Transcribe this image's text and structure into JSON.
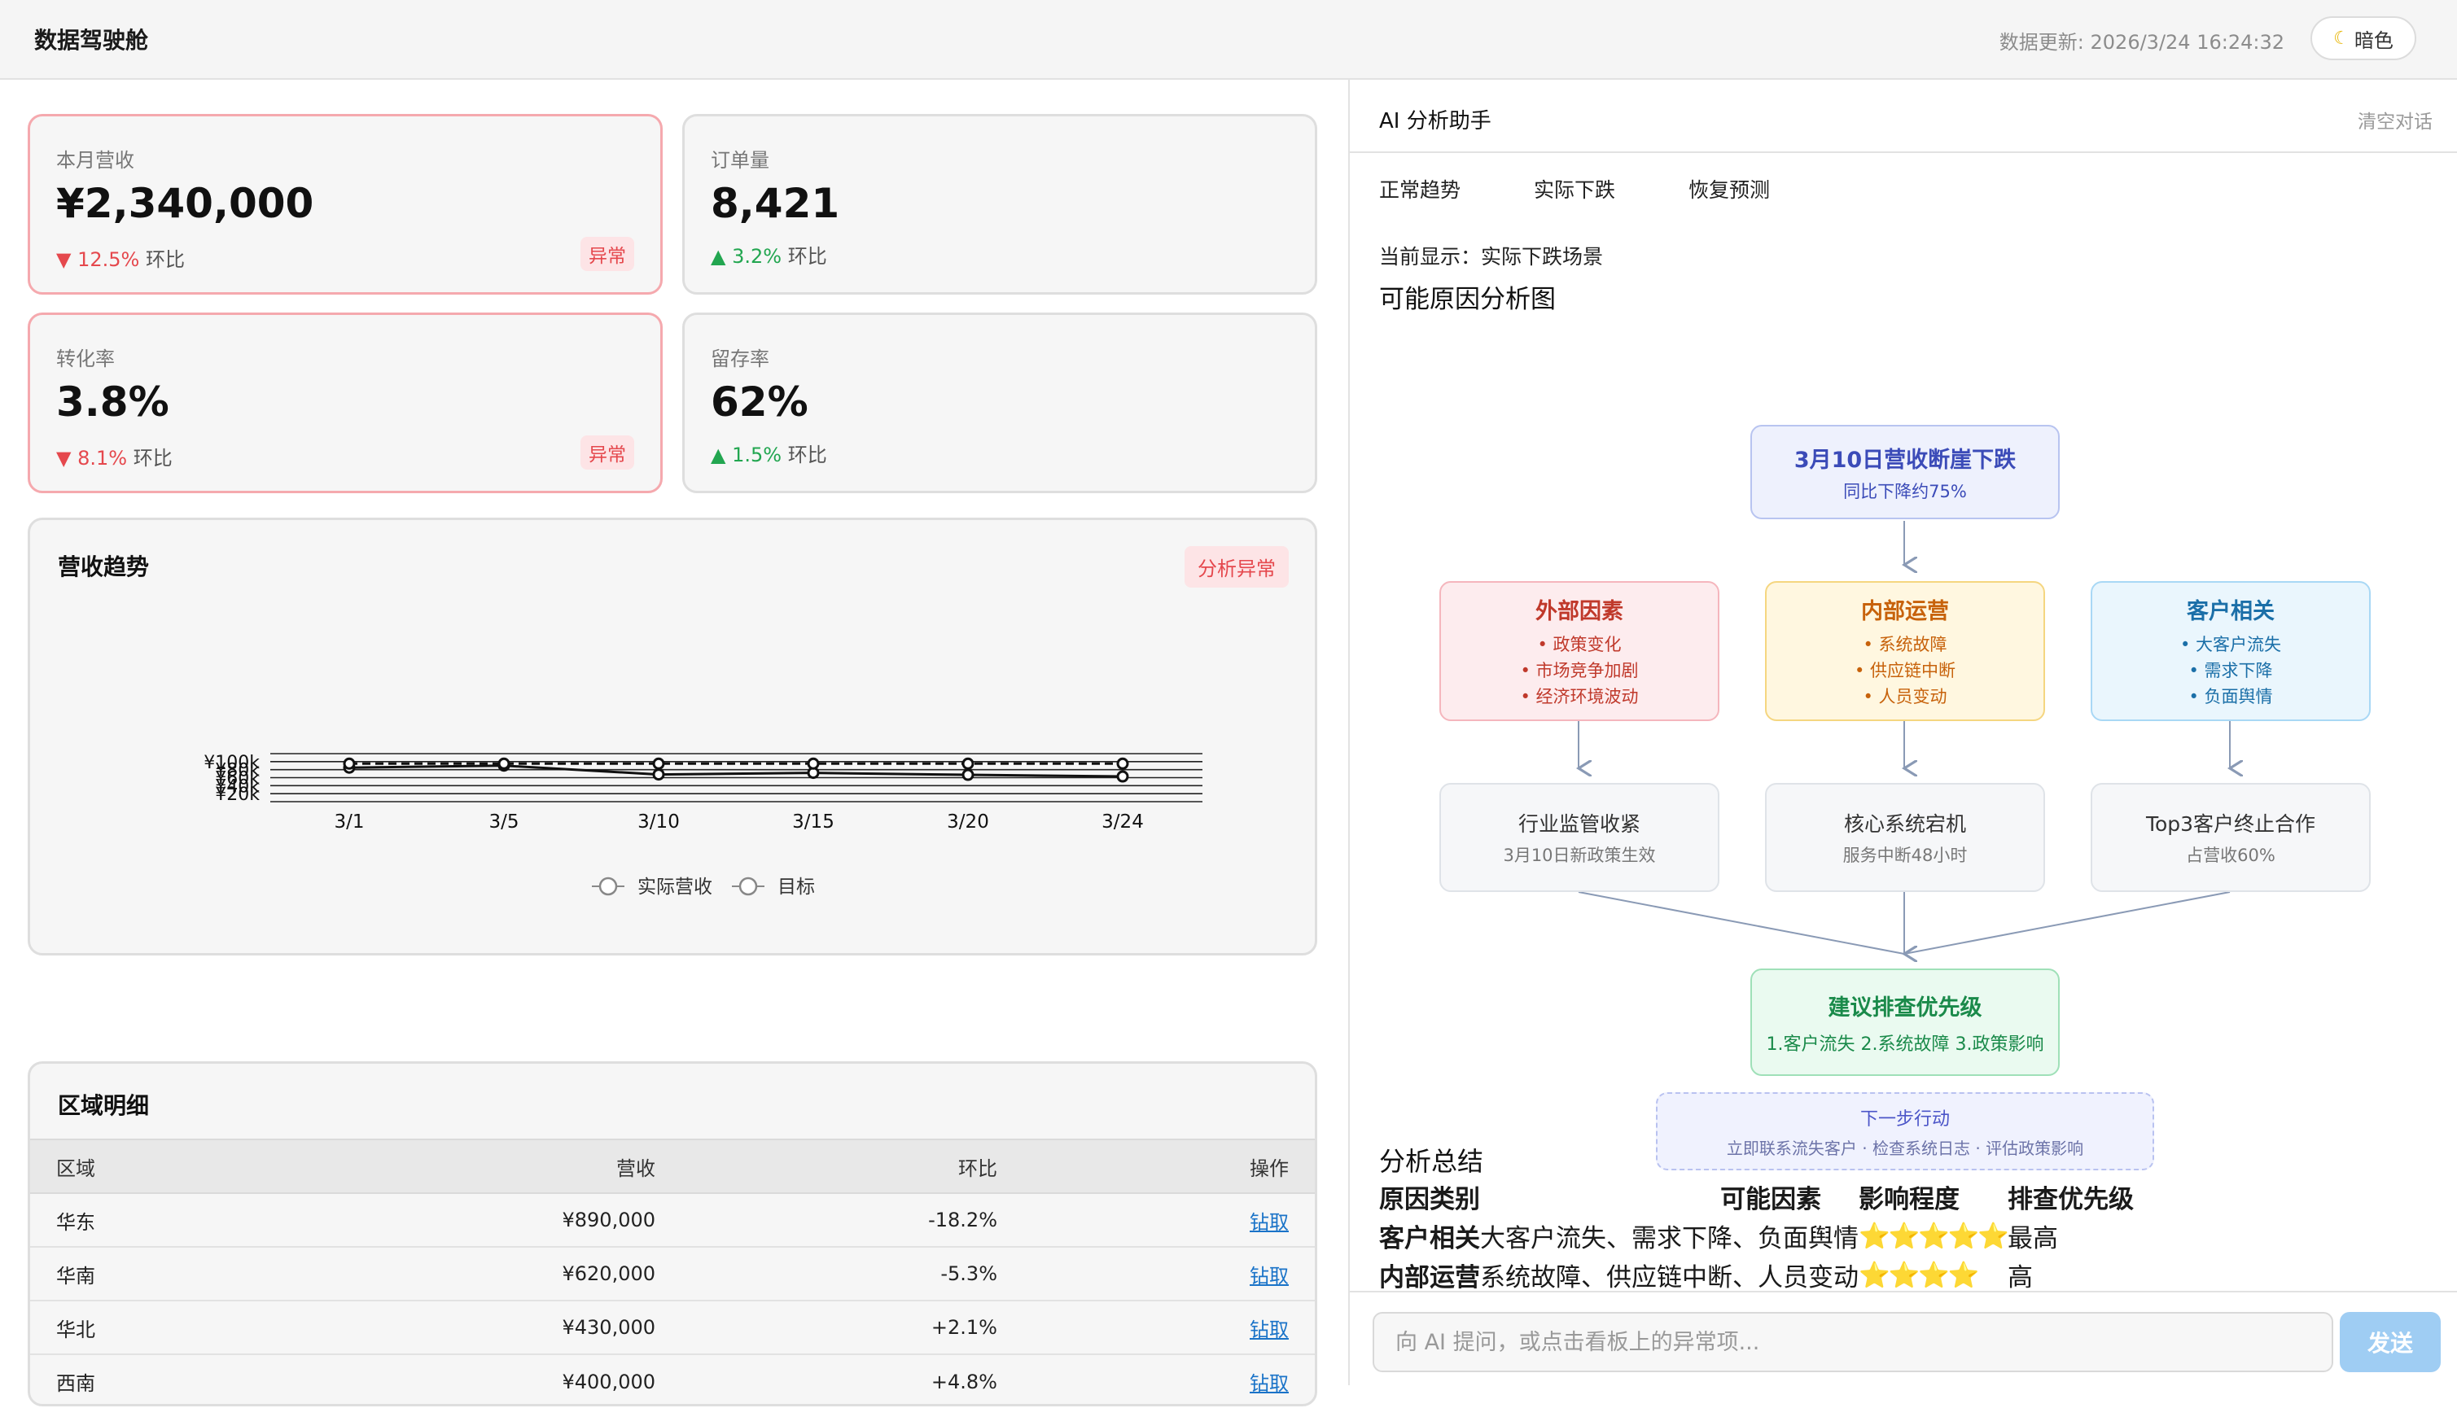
{
  "header": {
    "title": "数据驾驶舱",
    "update_text": "数据更新: 2026/3/24 16:24:32",
    "theme_label": "暗色"
  },
  "kpis": [
    {
      "label": "本月营收",
      "value": "¥2,340,000",
      "arrow": "▼",
      "change": "12.5%",
      "suffix": "环比",
      "trend": "down",
      "badge": "异常"
    },
    {
      "label": "订单量",
      "value": "8,421",
      "arrow": "▲",
      "change": "3.2%",
      "suffix": "环比",
      "trend": "up",
      "badge": ""
    },
    {
      "label": "转化率",
      "value": "3.8%",
      "arrow": "▼",
      "change": "8.1%",
      "suffix": "环比",
      "trend": "down",
      "badge": "异常"
    },
    {
      "label": "留存率",
      "value": "62%",
      "arrow": "▲",
      "change": "1.5%",
      "suffix": "环比",
      "trend": "up",
      "badge": ""
    }
  ],
  "revenue_panel": {
    "title": "营收趋势",
    "analyze_label": "分析异常"
  },
  "chart_data": {
    "type": "line",
    "x": [
      "3/1",
      "3/5",
      "3/10",
      "3/15",
      "3/20",
      "3/24"
    ],
    "series": [
      {
        "name": "实际营收",
        "values": [
          85,
          90,
          68,
          72,
          67,
          63
        ],
        "style": "solid"
      },
      {
        "name": "目标",
        "values": [
          95,
          95,
          95,
          95,
          95,
          95
        ],
        "style": "dashed"
      }
    ],
    "y_ticks": [
      "¥20k",
      "¥40k",
      "¥60k",
      "¥80k",
      "¥100k"
    ],
    "ylim": [
      0,
      120
    ],
    "grid": true,
    "legend_position": "bottom"
  },
  "region": {
    "title": "区域明细",
    "headers": [
      "区域",
      "营收",
      "环比",
      "操作"
    ],
    "rows": [
      {
        "region": "华东",
        "revenue": "¥890,000",
        "change": "-18.2%",
        "trend": "down",
        "action": "钻取"
      },
      {
        "region": "华南",
        "revenue": "¥620,000",
        "change": "-5.3%",
        "trend": "down",
        "action": "钻取"
      },
      {
        "region": "华北",
        "revenue": "¥430,000",
        "change": "+2.1%",
        "trend": "up",
        "action": "钻取"
      },
      {
        "region": "西南",
        "revenue": "¥400,000",
        "change": "+4.8%",
        "trend": "up",
        "action": "钻取"
      }
    ]
  },
  "ai": {
    "title": "AI 分析助手",
    "clear_label": "清空对话",
    "tabs": [
      "正常趋势",
      "实际下跌",
      "恢复预测"
    ],
    "current_display": "当前显示：实际下跌场景",
    "flow_title": "可能原因分析图",
    "diagram": {
      "root": {
        "title": "3月10日营收断崖下跌",
        "sub": "同比下降约75%"
      },
      "causes": [
        {
          "title": "外部因素",
          "items": [
            "• 政策变化",
            "• 市场竞争加剧",
            "• 经济环境波动"
          ],
          "color": "#c0392b",
          "bg": "#fdecee",
          "border": "#f5b6bd"
        },
        {
          "title": "内部运营",
          "items": [
            "• 系统故障",
            "• 供应链中断",
            "• 人员变动"
          ],
          "color": "#c7620b",
          "bg": "#fff7e0",
          "border": "#f5d680"
        },
        {
          "title": "客户相关",
          "items": [
            "• 大客户流失",
            "• 需求下降",
            "• 负面舆情"
          ],
          "color": "#1b6fa8",
          "bg": "#eaf6fd",
          "border": "#a9d8f5"
        }
      ],
      "details": [
        {
          "title": "行业监管收紧",
          "sub": "3月10日新政策生效"
        },
        {
          "title": "核心系统宕机",
          "sub": "服务中断48小时"
        },
        {
          "title": "Top3客户终止合作",
          "sub": "占营收60%"
        }
      ],
      "priority": {
        "title": "建议排查优先级",
        "sub": "1.客户流失 2.系统故障 3.政策影响"
      },
      "next": {
        "title": "下一步行动",
        "sub": "立即联系流失客户 · 检查系统日志 · 评估政策影响"
      }
    },
    "summary_title": "分析总结",
    "summary_headers": [
      "原因类别",
      "可能因素",
      "影响程度",
      "排查优先级"
    ],
    "summary_rows": [
      {
        "category": "客户相关",
        "factors": "大客户流失、需求下降、负面舆情",
        "stars": "⭐⭐⭐⭐⭐",
        "priority": "最高"
      },
      {
        "category": "内部运营",
        "factors": "系统故障、供应链中断、人员变动",
        "stars": "⭐⭐⭐⭐",
        "priority": "高"
      }
    ],
    "input_placeholder": "向 AI 提问，或点击看板上的异常项...",
    "send_label": "发送"
  }
}
